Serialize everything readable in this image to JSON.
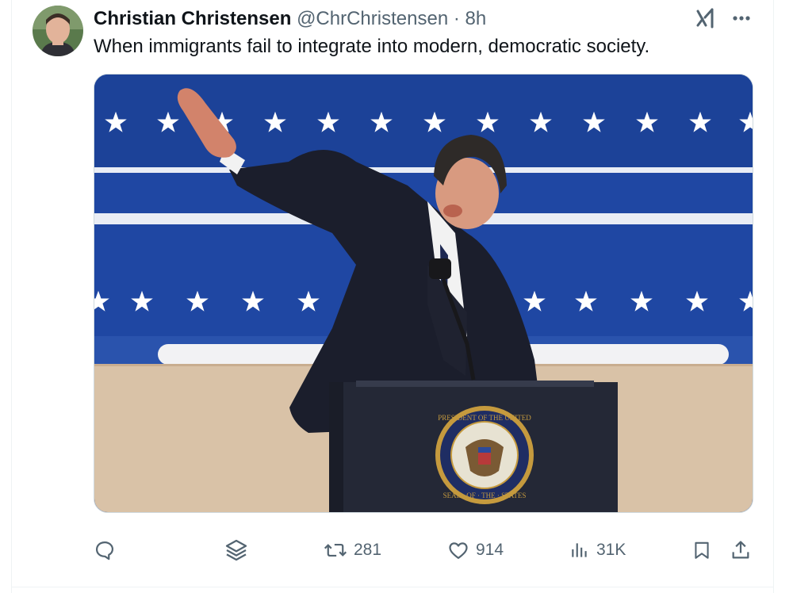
{
  "tweet": {
    "author_name": "Christian Christensen",
    "author_handle": "@ChrChristensen",
    "separator": "·",
    "timestamp": "8h",
    "text": "When immigrants fail to integrate into modern, democratic society."
  },
  "image": {
    "seal_top_text": "PRESIDENT OF THE UNITED",
    "seal_bottom_text": "SEAL · OF · THE · STATES"
  },
  "actions": {
    "reply_count": "",
    "grok_count": "",
    "retweet_count": "281",
    "like_count": "914",
    "views_count": "31K"
  },
  "icons": [
    "avatar",
    "grok-icon",
    "more-icon",
    "reply-icon",
    "grok-stack-icon",
    "retweet-icon",
    "like-icon",
    "views-icon",
    "bookmark-icon",
    "share-icon"
  ],
  "colors": {
    "text_primary": "#0f1419",
    "text_secondary": "#536471",
    "border": "#cfd9de",
    "backdrop_blue": "#1f47a3",
    "backdrop_tan": "#d9c2a7"
  }
}
